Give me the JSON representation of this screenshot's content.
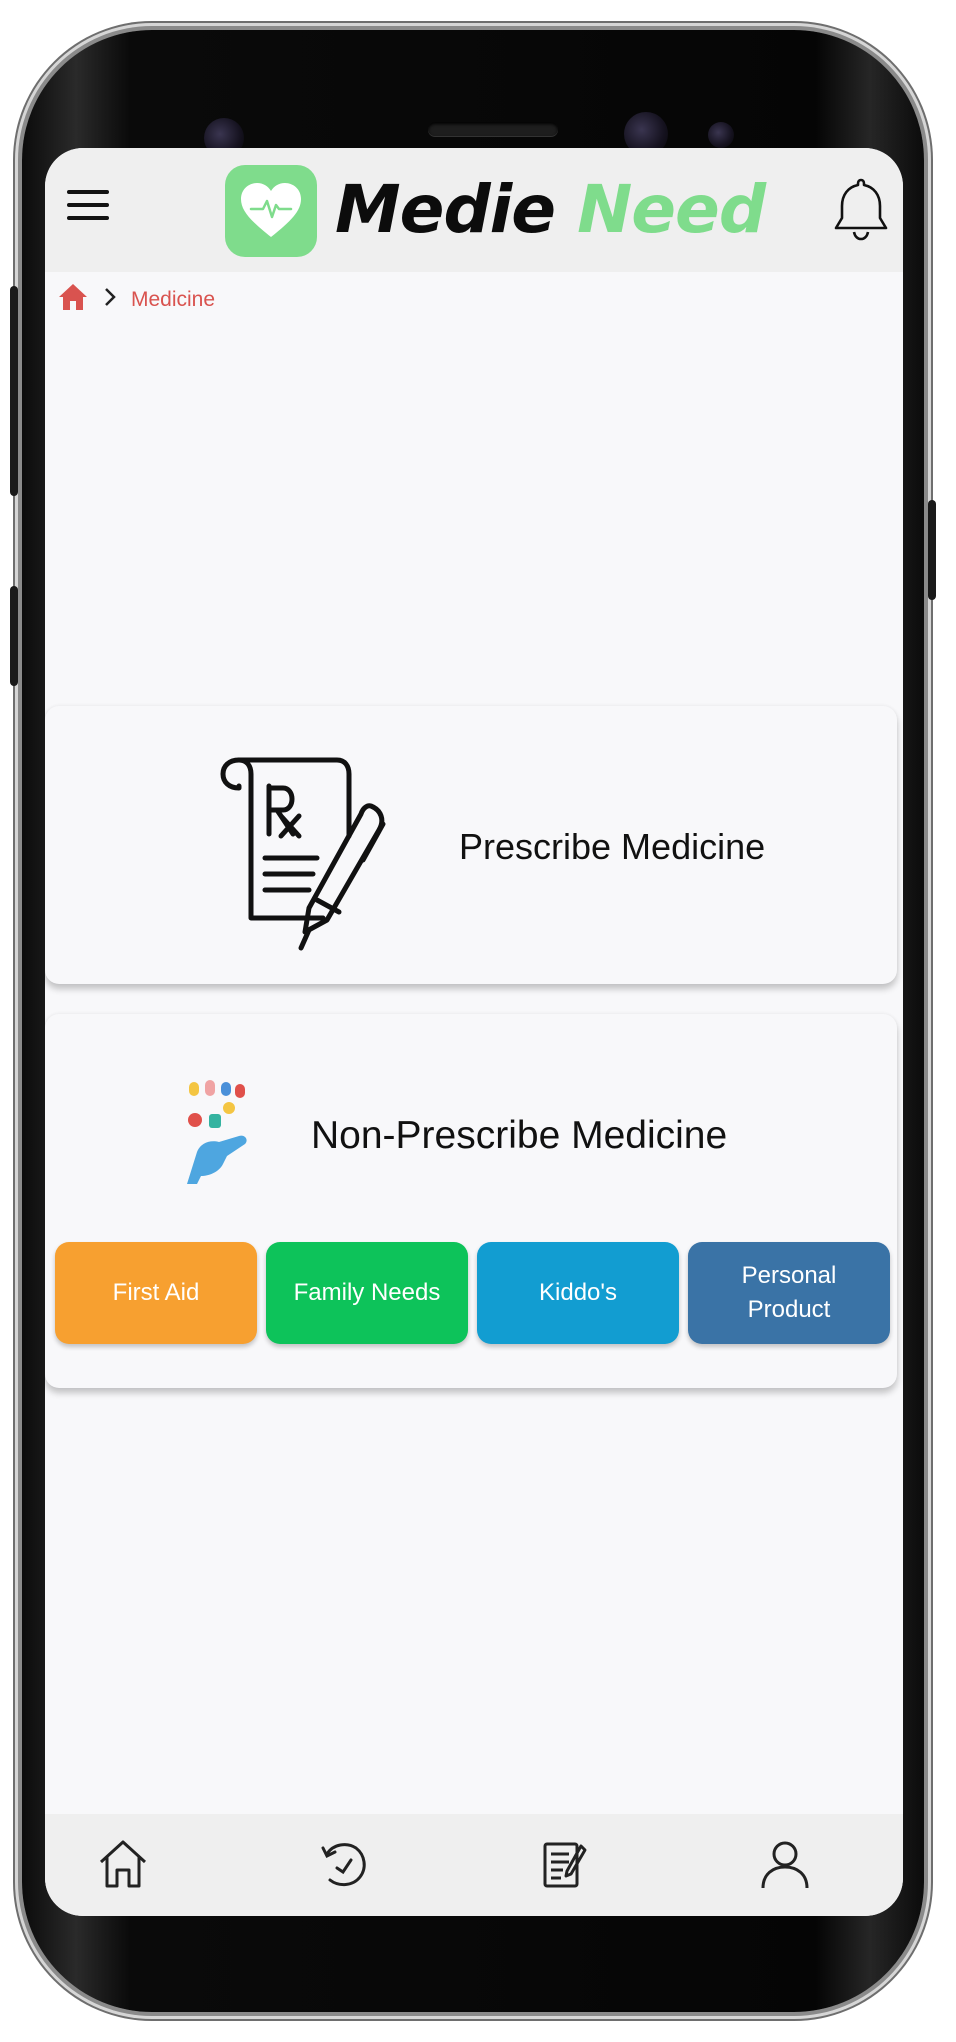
{
  "app": {
    "brand_part1": "Medie",
    "brand_part2": "Need",
    "brand_color": "#7fdc8c"
  },
  "header": {
    "menu_icon": "hamburger-menu-icon",
    "logo_icon": "heart-pulse-icon",
    "notification_icon": "bell-icon"
  },
  "breadcrumb": {
    "home_icon": "home-icon",
    "separator_icon": "chevron-right-icon",
    "current": "Medicine",
    "color": "#d9534f"
  },
  "prescribe": {
    "icon": "prescription-rx-pen-icon",
    "title": "Prescribe Medicine"
  },
  "non_prescribe": {
    "icon": "hand-with-pills-icon",
    "title": "Non-Prescribe Medicine",
    "categories": [
      {
        "label": "First Aid",
        "color": "#f7a030"
      },
      {
        "label": "Family Needs",
        "color": "#0dc35a"
      },
      {
        "label": "Kiddo's",
        "color": "#129dd1"
      },
      {
        "label": "Personal Product",
        "color": "#3a73a6"
      }
    ]
  },
  "bottom_nav": {
    "items": [
      {
        "icon": "home-outline-icon"
      },
      {
        "icon": "history-clock-icon"
      },
      {
        "icon": "orders-list-icon"
      },
      {
        "icon": "user-profile-icon"
      }
    ]
  }
}
